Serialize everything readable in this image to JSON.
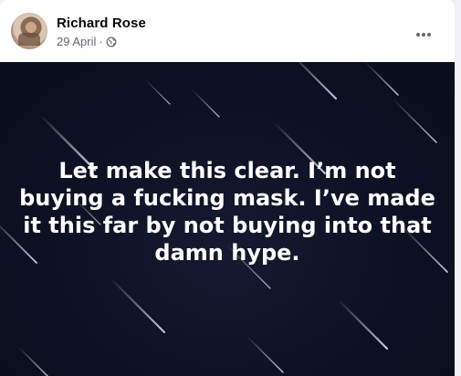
{
  "post": {
    "author": "Richard Rose",
    "date": "29 April",
    "separator": "·",
    "privacy_icon": "globe-icon",
    "more_icon": "more-options-icon",
    "text": "Let make this clear. I’m not buying a fucking mask. I’ve made it this far by not buying into that damn hype."
  },
  "colors": {
    "author": "#050505",
    "meta": "#65676b",
    "media_background": "#0d1124",
    "overlay_text": "#ffffff"
  }
}
